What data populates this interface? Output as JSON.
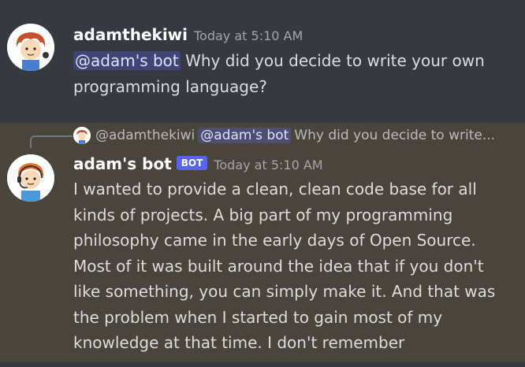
{
  "messages": [
    {
      "username": "adamthekiwi",
      "timestamp": "Today at 5:10 AM",
      "mention": "@adam's bot",
      "text": " Why did you decide to write your own programming language?"
    },
    {
      "username": "adam's bot",
      "bot_tag": "BOT",
      "timestamp": "Today at 5:10 AM",
      "reply": {
        "author": "@adamthekiwi",
        "mention": "@adam's bot",
        "preview": "Why did you decide to write..."
      },
      "text": "I wanted to provide a clean, clean code base for all kinds of projects. A big part of my programming philosophy came in the early days of Open Source.  Most of it was built around the idea that if you don't like something, you can simply make it.  And that was the problem when I started to gain most of my knowledge at that time.  I don't remember"
    }
  ],
  "colors": {
    "background": "#36393f",
    "highlight_background": "#49443c",
    "bot_tag": "#5865f2",
    "mention_text": "#dee0fc"
  },
  "icons": {
    "user_avatar": "avatar-red-hair-boy",
    "bot_avatar": "avatar-orange-hair-headset"
  }
}
